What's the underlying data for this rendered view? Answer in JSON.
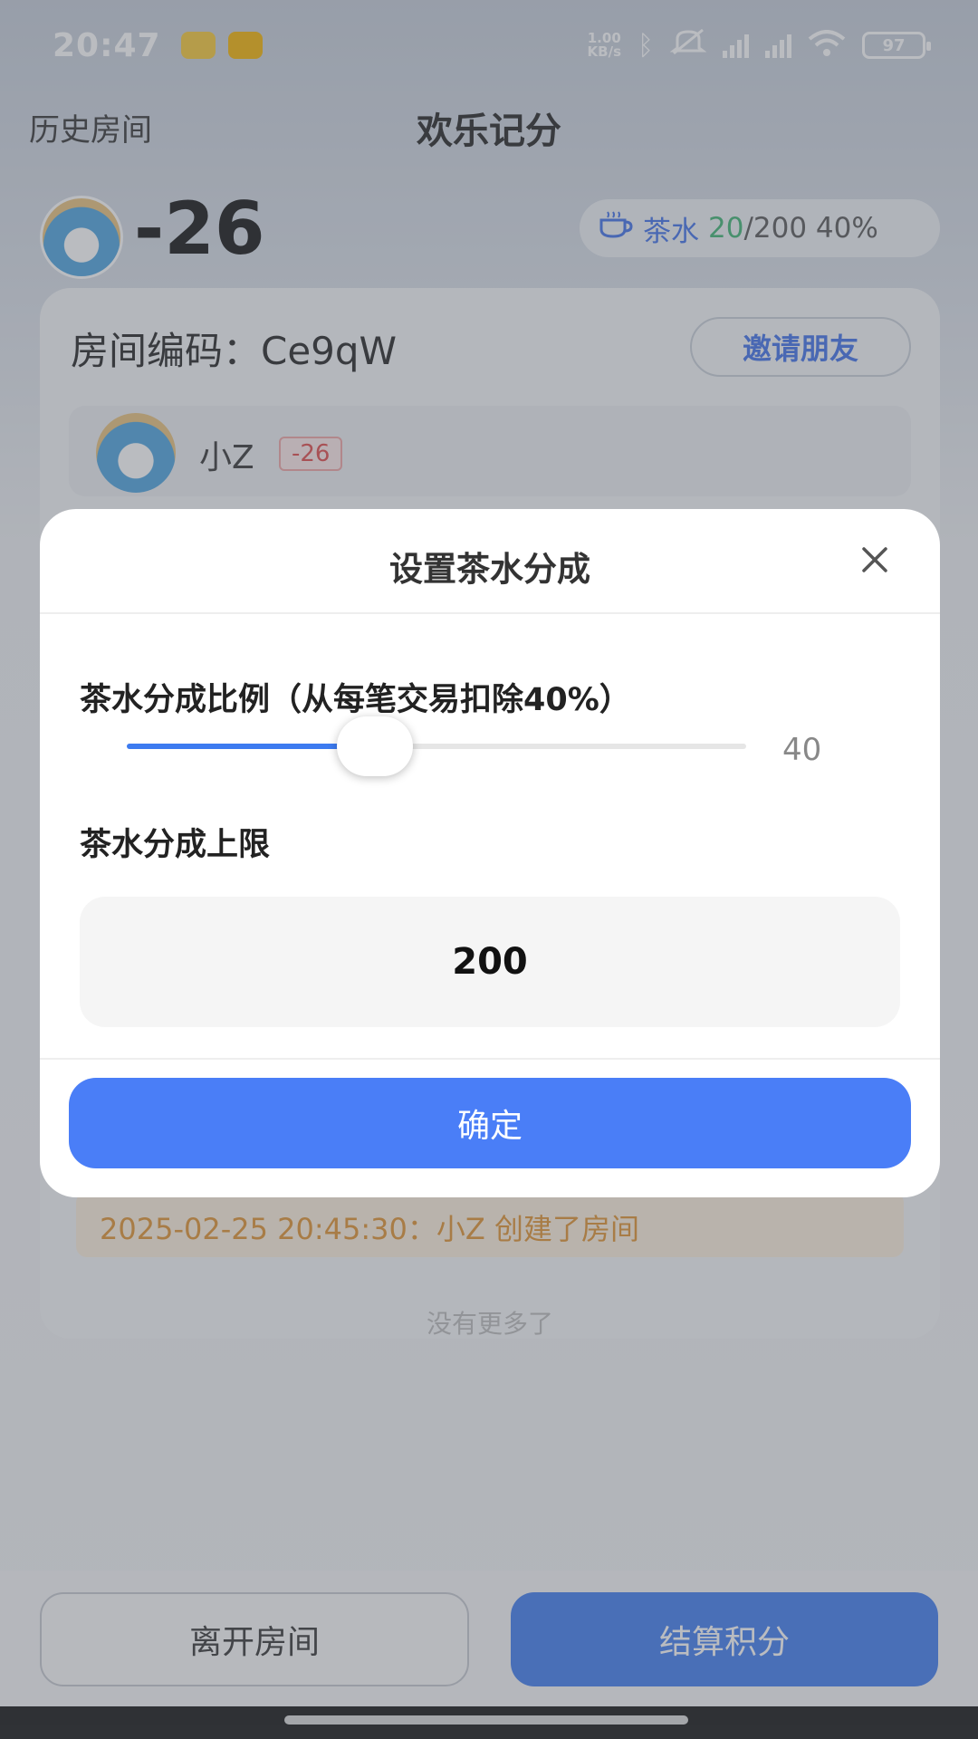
{
  "status_bar": {
    "time": "20:47",
    "net_speed_value": "1.00",
    "net_speed_unit": "KB/s",
    "battery": "97"
  },
  "nav": {
    "history_label": "历史房间",
    "title": "欢乐记分"
  },
  "me": {
    "score": "-26"
  },
  "tea": {
    "label": "茶水",
    "current": "20",
    "rest": "/200 40%"
  },
  "room": {
    "code_label": "房间编码：Ce9qW",
    "invite_label": "邀请朋友",
    "players": [
      {
        "name": "小Z",
        "score": "-26"
      }
    ],
    "log": "2025-02-25 20:45:30：小Z 创建了房间",
    "faded_text": "没有更多了"
  },
  "modal": {
    "title": "设置茶水分成",
    "ratio_label": "茶水分成比例（从每笔交易扣除40%）",
    "ratio_value": 40,
    "ratio_display": "40",
    "ratio_max": 100,
    "cap_label": "茶水分成上限",
    "cap_value": "200",
    "confirm_label": "确定"
  },
  "bottom": {
    "leave_label": "离开房间",
    "settle_label": "结算积分"
  },
  "colors": {
    "accent": "#3d7bf0",
    "tea_current": "#3cb371",
    "badge_red": "#e04848",
    "log_orange": "#e0922e"
  },
  "icons": {
    "close": "close-icon",
    "tea": "tea-cup-icon",
    "bluetooth": "bluetooth-icon",
    "wifi": "wifi-icon"
  }
}
